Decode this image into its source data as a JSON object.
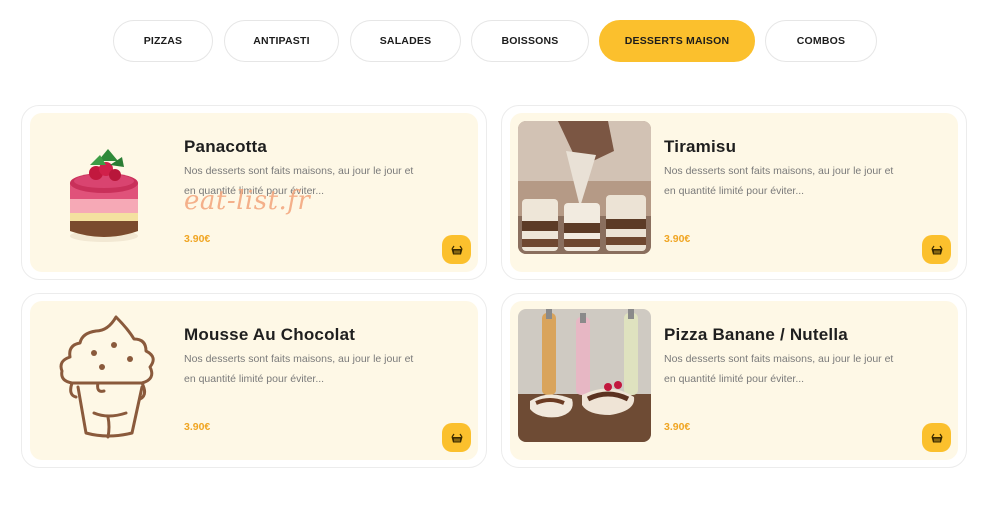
{
  "tabs": [
    {
      "label": "PIZZAS"
    },
    {
      "label": "ANTIPASTI"
    },
    {
      "label": "SALADES"
    },
    {
      "label": "BOISSONS"
    },
    {
      "label": "DESSERTS MAISON"
    },
    {
      "label": "COMBOS"
    }
  ],
  "active_tab": "DESSERTS MAISON",
  "accent_color": "#fbc02d",
  "card_background": "#fef8e6",
  "price_color": "#f0a522",
  "products": [
    {
      "name": "Panacotta",
      "desc_line1": "Nos desserts sont faits maisons, au jour le jour et",
      "desc_line2": "en quantité limité pour éviter...",
      "price": "3.90€",
      "image": "layered-cake-illustration"
    },
    {
      "name": "Tiramisu",
      "desc_line1": "Nos desserts sont faits maisons, au jour le jour et",
      "desc_line2": "en quantité limité pour éviter...",
      "price": "3.90€",
      "image": "tiramisu-cups-photo"
    },
    {
      "name": "Mousse Au Chocolat",
      "desc_line1": "Nos desserts sont faits maisons, au jour le jour et",
      "desc_line2": "en quantité limité pour éviter...",
      "price": "3.90€",
      "image": "cupcake-outline-icon"
    },
    {
      "name": "Pizza Banane / Nutella",
      "desc_line1": "Nos desserts sont faits maisons, au jour le jour et",
      "desc_line2": "en quantité limité pour éviter...",
      "price": "3.90€",
      "image": "dessert-pizza-photo"
    }
  ],
  "cart_icon": "basket-icon",
  "watermark": "eat-list.fr"
}
